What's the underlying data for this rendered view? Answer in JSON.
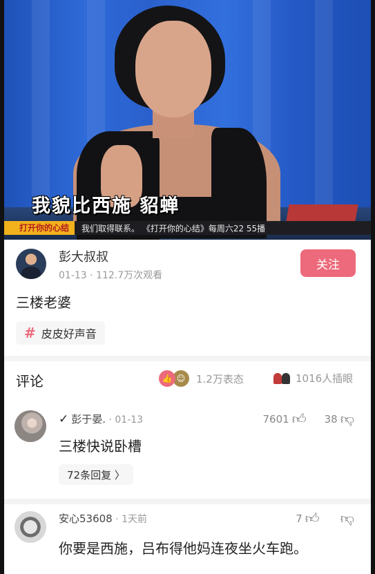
{
  "video": {
    "subtitle": "我貌比西施 貂蝉",
    "ticker_tag": "打开你的心结",
    "ticker_text": "我们取得联系。 《打开你的心结》每周六22 55播"
  },
  "author": {
    "name": "彭大叔叔",
    "meta": "01-13 · 112.7万次观看",
    "follow_label": "关注"
  },
  "post": {
    "text": "三楼老婆",
    "topic": "皮皮好声音"
  },
  "comments_header": {
    "title": "评论",
    "reaction_count": "1.2万表态",
    "insert_count": "1016人插眼"
  },
  "comments": [
    {
      "name": "彭于晏.",
      "date": "· 01-13",
      "likes": "7601",
      "dislikes": "38",
      "text": "三楼快说卧槽",
      "replies": "72条回复 〉"
    },
    {
      "name": "安心53608",
      "date": "· 1天前",
      "likes": "7",
      "dislikes": "",
      "text": "你要是西施，吕布得他妈连夜坐火车跑。"
    }
  ],
  "icons": {
    "thumb_up": "👍",
    "thumb_down": "👎",
    "check": "✓",
    "hash": "#"
  },
  "colors": {
    "accent": "#ec6a7b"
  }
}
